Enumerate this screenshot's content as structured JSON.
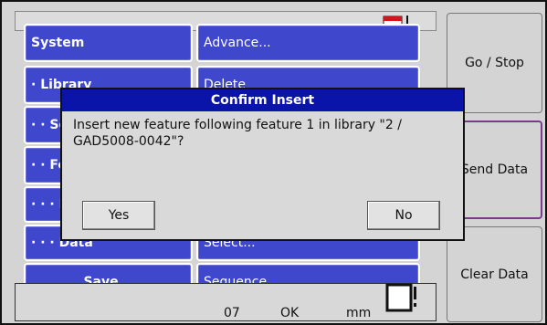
{
  "menu": {
    "left": [
      {
        "label": "System"
      },
      {
        "label": "· Library"
      },
      {
        "label": "· · Se"
      },
      {
        "label": "· · Fe"
      },
      {
        "label": "· · · M"
      },
      {
        "label": "· · · Data"
      },
      {
        "label": "Save..."
      }
    ],
    "right": [
      {
        "label": "Advance..."
      },
      {
        "label": "Delete"
      },
      {
        "label": "Select..."
      },
      {
        "label": "Sequence..."
      }
    ]
  },
  "side": {
    "go_stop": "Go / Stop",
    "send_data": "Send Data",
    "clear_data": "Clear Data"
  },
  "status": {
    "c1": "07",
    "c2": "OK",
    "c3": "mm"
  },
  "dialog": {
    "title": "Confirm Insert",
    "message": "Insert new feature following feature 1 in library \"2 / GAD5008-0042\"?",
    "yes_label": "Yes",
    "no_label": "No"
  },
  "colors": {
    "menu_blue": "#3f48cc",
    "title_blue": "#0a14a8",
    "panel_gray": "#d4d4d4"
  }
}
